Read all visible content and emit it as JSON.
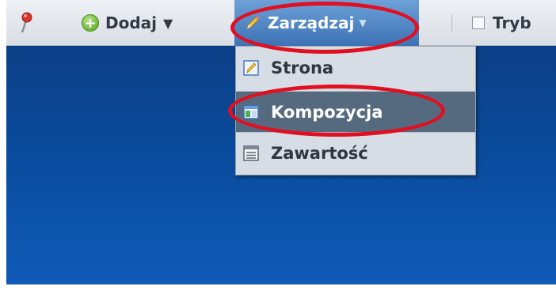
{
  "toolbar": {
    "add_label": "Dodaj",
    "add_arrow": "▼",
    "manage_label": "Zarządzaj",
    "manage_arrow": "▼",
    "mode_label": "Tryb"
  },
  "dropdown": {
    "items": [
      {
        "label": "Strona",
        "icon": "page-edit-icon"
      },
      {
        "label": "Kompozycja",
        "icon": "layout-icon",
        "highlighted": true
      },
      {
        "label": "Zawartość",
        "icon": "content-list-icon"
      }
    ]
  },
  "colors": {
    "canvas_blue": "#0c3f86",
    "toolbar_bg": "#e3e7ed",
    "highlight_red": "#e10f1f",
    "selected_item_bg": "#566a7f",
    "manage_button_bg": "#3d72b5"
  }
}
